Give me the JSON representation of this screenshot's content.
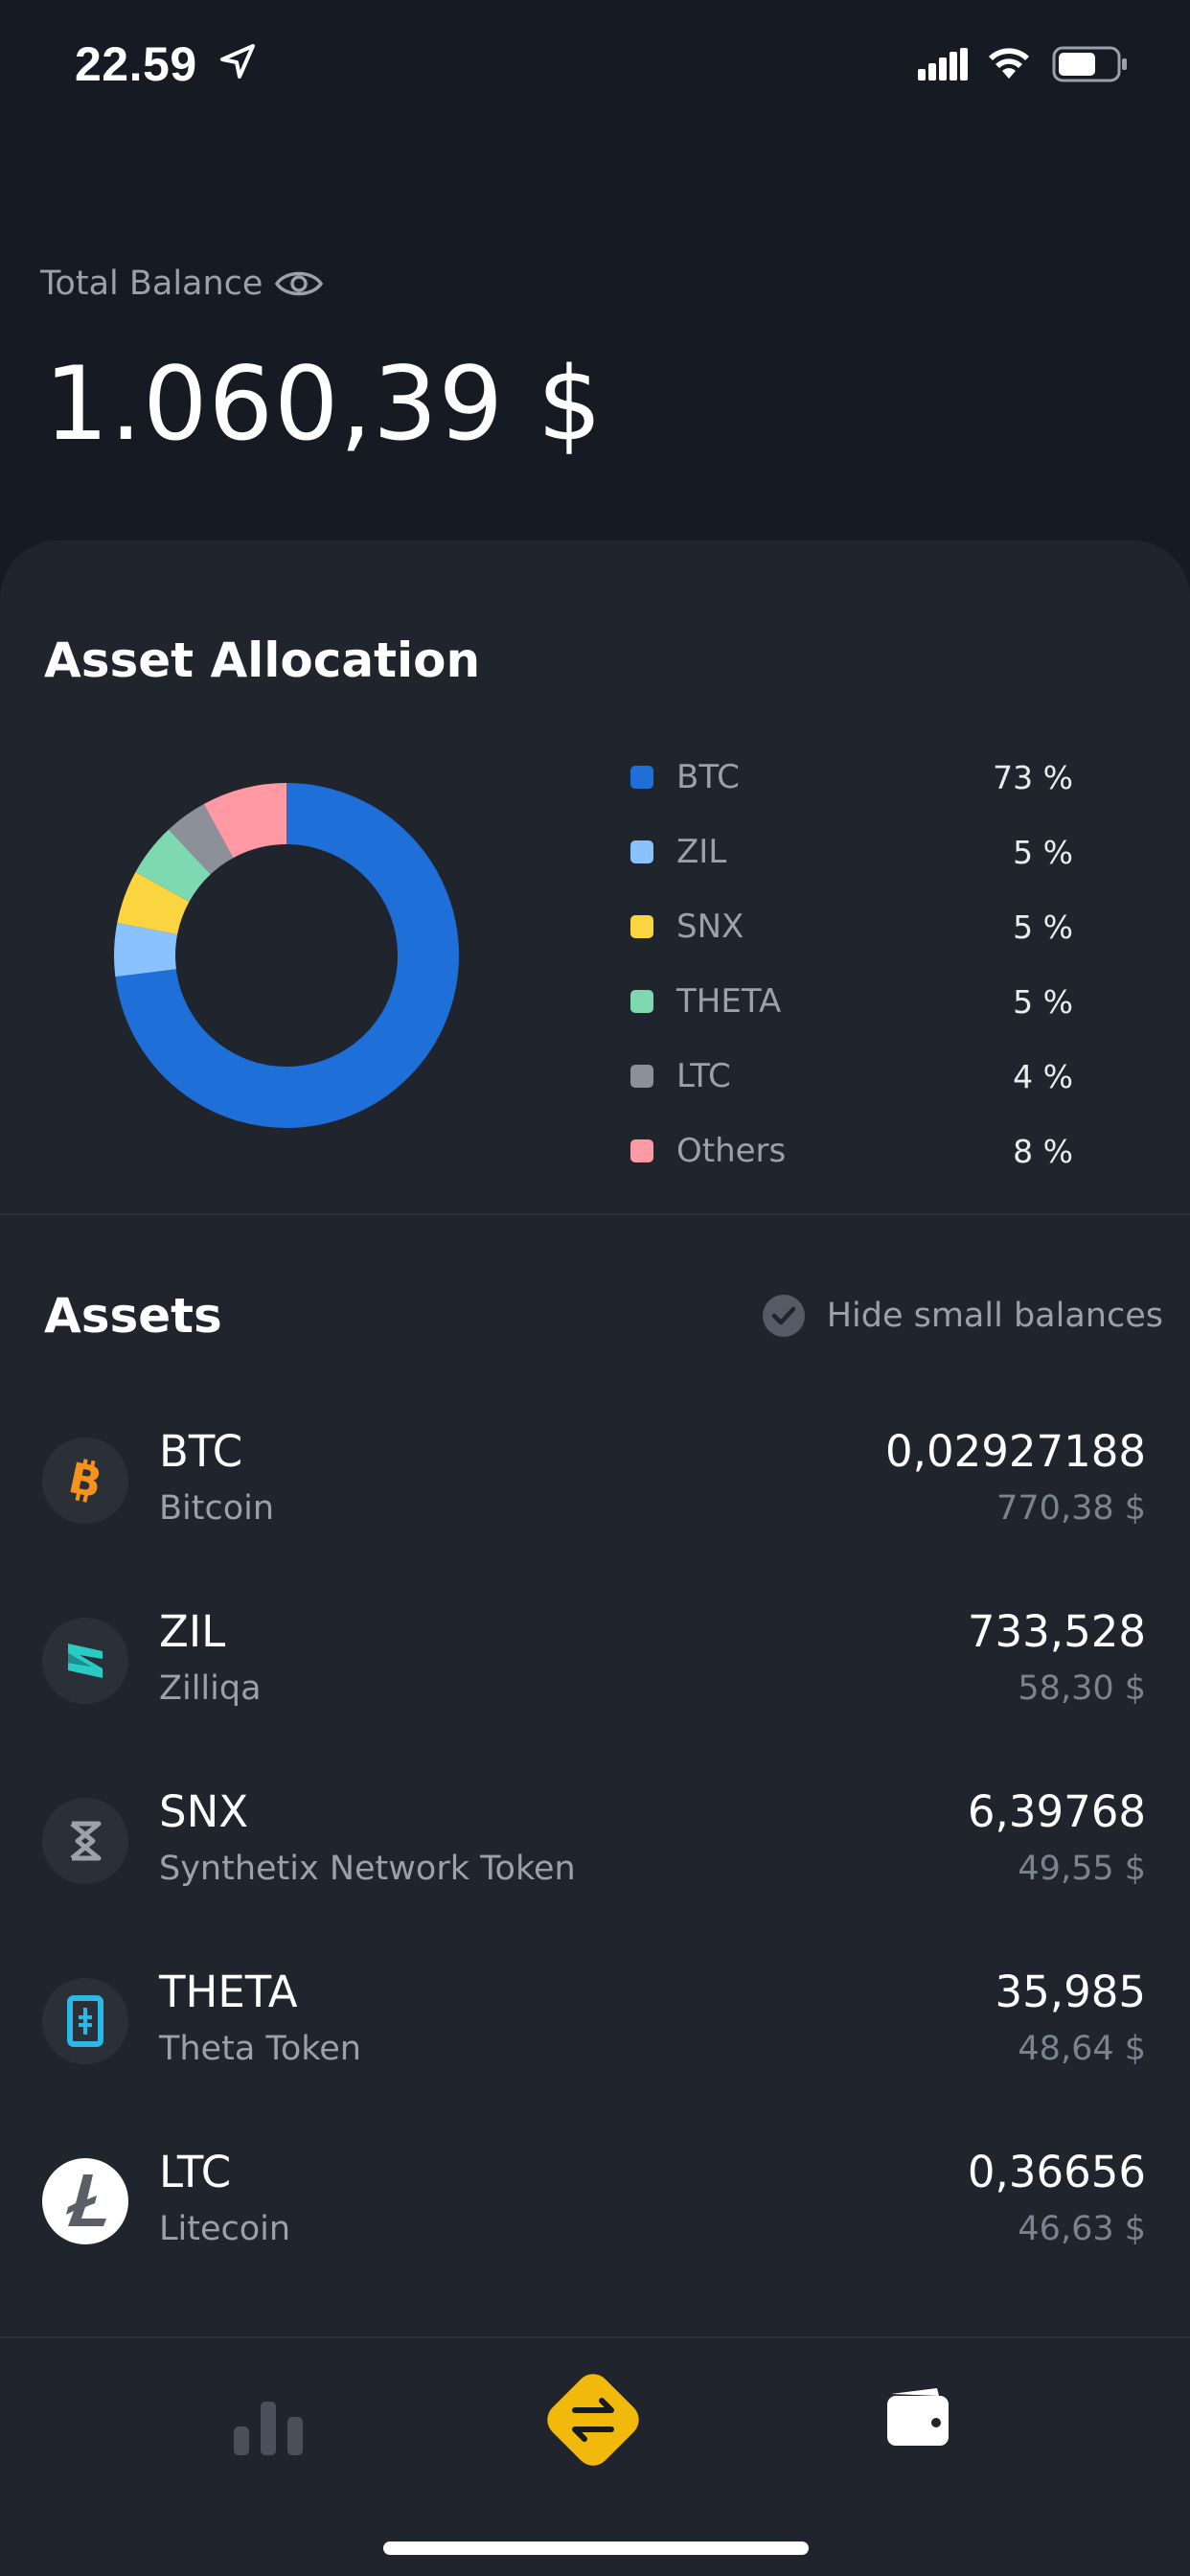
{
  "status_bar": {
    "time": "22.59"
  },
  "balance": {
    "label": "Total Balance",
    "value": "1.060,39 $"
  },
  "allocation": {
    "title": "Asset Allocation",
    "items": [
      {
        "label": "BTC",
        "percent": "73 %",
        "share": 73,
        "color": "#1f6fd9"
      },
      {
        "label": "ZIL",
        "percent": "5 %",
        "share": 5,
        "color": "#89c2ff"
      },
      {
        "label": "SNX",
        "percent": "5 %",
        "share": 5,
        "color": "#fad540"
      },
      {
        "label": "THETA",
        "percent": "5 %",
        "share": 5,
        "color": "#7ed9b0"
      },
      {
        "label": "LTC",
        "percent": "4 %",
        "share": 4,
        "color": "#8b9099"
      },
      {
        "label": "Others",
        "percent": "8 %",
        "share": 8,
        "color": "#ff9aa4"
      }
    ]
  },
  "assets": {
    "title": "Assets",
    "hide_small_label": "Hide small balances",
    "rows": [
      {
        "symbol": "BTC",
        "name": "Bitcoin",
        "amount": "0,02927188",
        "value": "770,38 $",
        "icon": "bitcoin-icon"
      },
      {
        "symbol": "ZIL",
        "name": "Zilliqa",
        "amount": "733,528",
        "value": "58,30 $",
        "icon": "zilliqa-icon"
      },
      {
        "symbol": "SNX",
        "name": "Synthetix Network Token",
        "amount": "6,39768",
        "value": "49,55 $",
        "icon": "synthetix-icon"
      },
      {
        "symbol": "THETA",
        "name": "Theta Token",
        "amount": "35,985",
        "value": "48,64 $",
        "icon": "theta-icon"
      },
      {
        "symbol": "LTC",
        "name": "Litecoin",
        "amount": "0,36656",
        "value": "46,63 $",
        "icon": "litecoin-icon"
      }
    ]
  },
  "colors": {
    "accent": "#f0b90b",
    "background": "#151a23",
    "card": "#1f242d"
  }
}
